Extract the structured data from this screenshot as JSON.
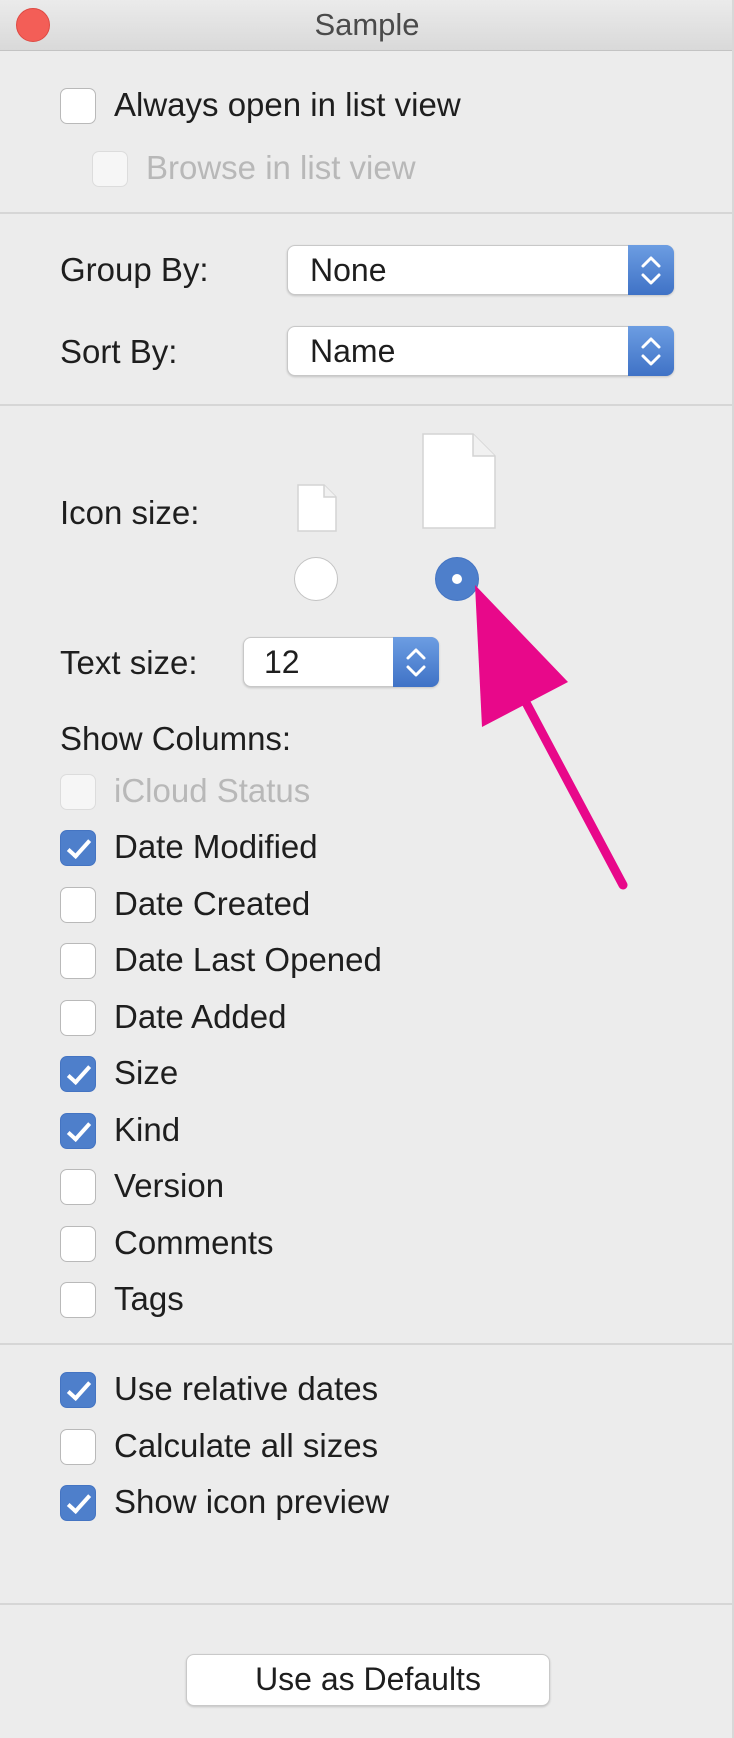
{
  "window": {
    "title": "Sample"
  },
  "list_view": {
    "always_open": {
      "label": "Always open in list view",
      "checked": false
    },
    "browse": {
      "label": "Browse in list view",
      "checked": false,
      "disabled": true
    }
  },
  "group_by": {
    "label": "Group By:",
    "value": "None"
  },
  "sort_by": {
    "label": "Sort By:",
    "value": "Name"
  },
  "icon_size": {
    "label": "Icon size:",
    "selected": "large"
  },
  "text_size": {
    "label": "Text size:",
    "value": "12"
  },
  "show_columns": {
    "label": "Show Columns:",
    "items": [
      {
        "label": "iCloud Status",
        "checked": false,
        "disabled": true
      },
      {
        "label": "Date Modified",
        "checked": true
      },
      {
        "label": "Date Created",
        "checked": false
      },
      {
        "label": "Date Last Opened",
        "checked": false
      },
      {
        "label": "Date Added",
        "checked": false
      },
      {
        "label": "Size",
        "checked": true
      },
      {
        "label": "Kind",
        "checked": true
      },
      {
        "label": "Version",
        "checked": false
      },
      {
        "label": "Comments",
        "checked": false
      },
      {
        "label": "Tags",
        "checked": false
      }
    ]
  },
  "options": {
    "items": [
      {
        "label": "Use relative dates",
        "checked": true
      },
      {
        "label": "Calculate all sizes",
        "checked": false
      },
      {
        "label": "Show icon preview",
        "checked": true
      }
    ]
  },
  "defaults_button": {
    "label": "Use as Defaults"
  },
  "colors": {
    "accent": "#4e7fcb",
    "annotation_arrow": "#e8088a",
    "close_button": "#f35e57"
  },
  "icons": [
    "close-icon",
    "popup-stepper-icon",
    "document-icon",
    "arrow-annotation-icon"
  ]
}
